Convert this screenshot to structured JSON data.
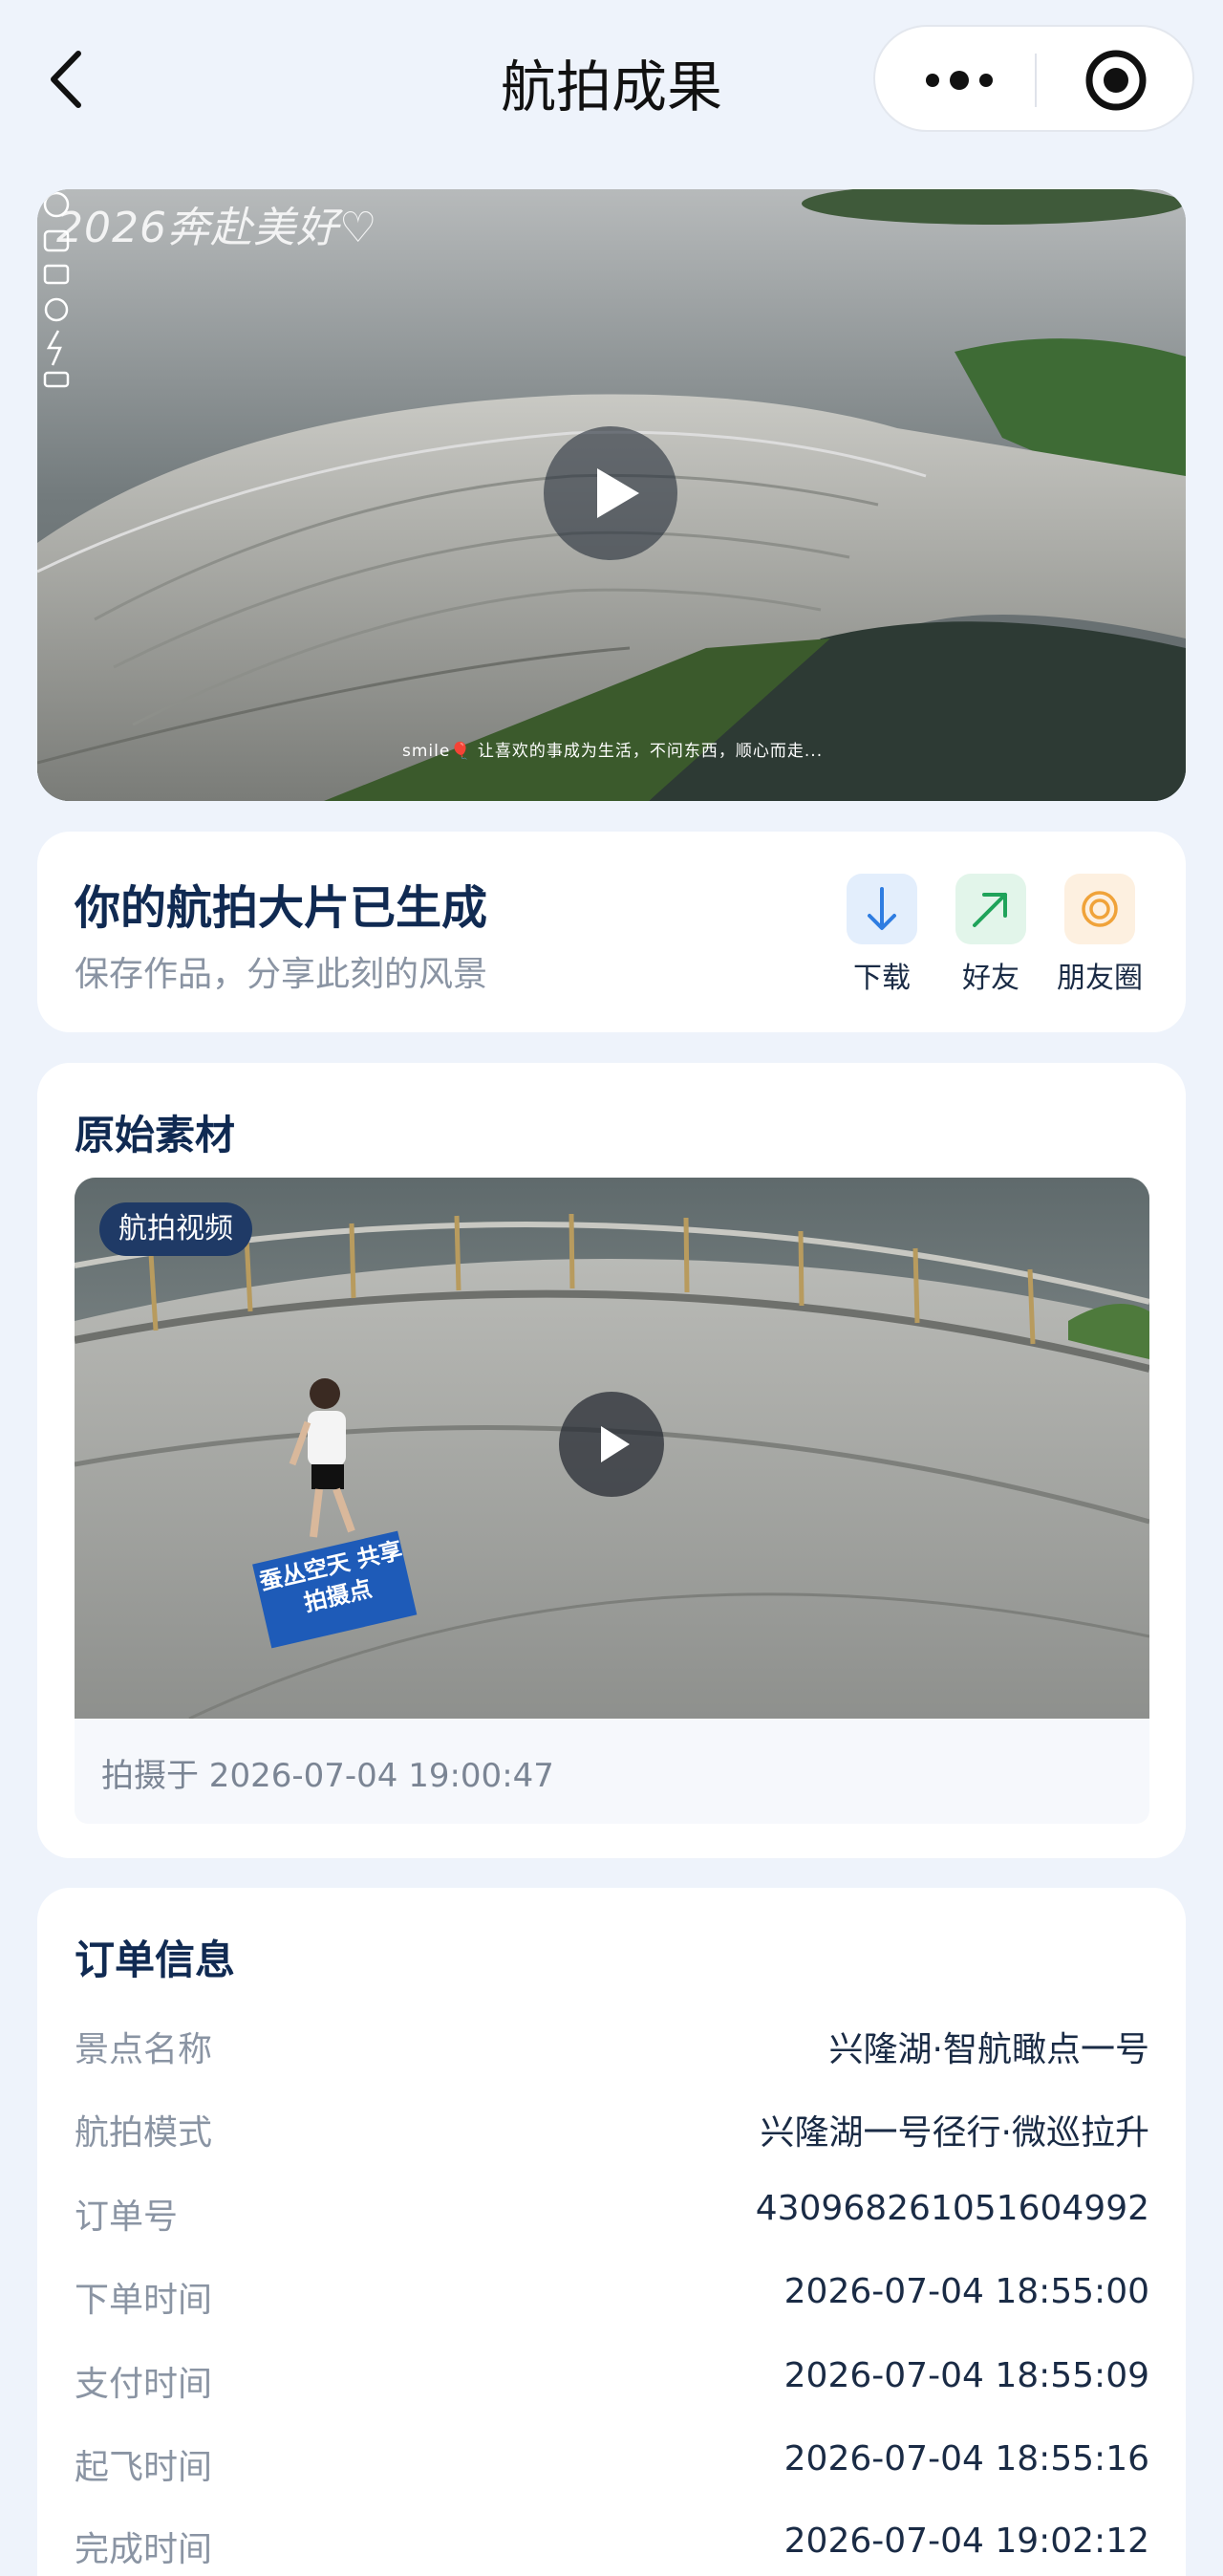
{
  "nav": {
    "title": "航拍成果",
    "back_icon": "chevron-left-icon",
    "more_icon": "more-dots-icon",
    "close_icon": "target-circle-icon"
  },
  "hero": {
    "watermark": "2026奔赴美好♡",
    "caption": "smile🎈 让喜欢的事成为生活，不问东西，顺心而走...",
    "play_icon": "play-icon"
  },
  "share": {
    "title": "你的航拍大片已生成",
    "subtitle": "保存作品，分享此刻的风景",
    "actions": [
      {
        "label": "下载",
        "icon": "download-arrow-icon",
        "bg": "#e3eefc",
        "color": "#2f7de1"
      },
      {
        "label": "好友",
        "icon": "share-arrow-icon",
        "bg": "#e2f5ea",
        "color": "#1fa35a"
      },
      {
        "label": "朋友圈",
        "icon": "moments-circle-icon",
        "bg": "#fdf0e0",
        "color": "#f0a33a"
      }
    ]
  },
  "raw": {
    "title": "原始素材",
    "badge": "航拍视频",
    "sign_text": "蚕丛空天 共享拍摄点",
    "shot_time": "拍摄于 2026-07-04 19:00:47"
  },
  "order": {
    "title": "订单信息",
    "rows": [
      {
        "key": "景点名称",
        "value": "兴隆湖·智航瞰点一号"
      },
      {
        "key": "航拍模式",
        "value": "兴隆湖一号径行·微巡拉升"
      },
      {
        "key": "订单号",
        "value": "430968261051604992"
      },
      {
        "key": "下单时间",
        "value": "2026-07-04 18:55:00"
      },
      {
        "key": "支付时间",
        "value": "2026-07-04 18:55:09"
      },
      {
        "key": "起飞时间",
        "value": "2026-07-04 18:55:16"
      },
      {
        "key": "完成时间",
        "value": "2026-07-04 19:02:12"
      }
    ]
  }
}
